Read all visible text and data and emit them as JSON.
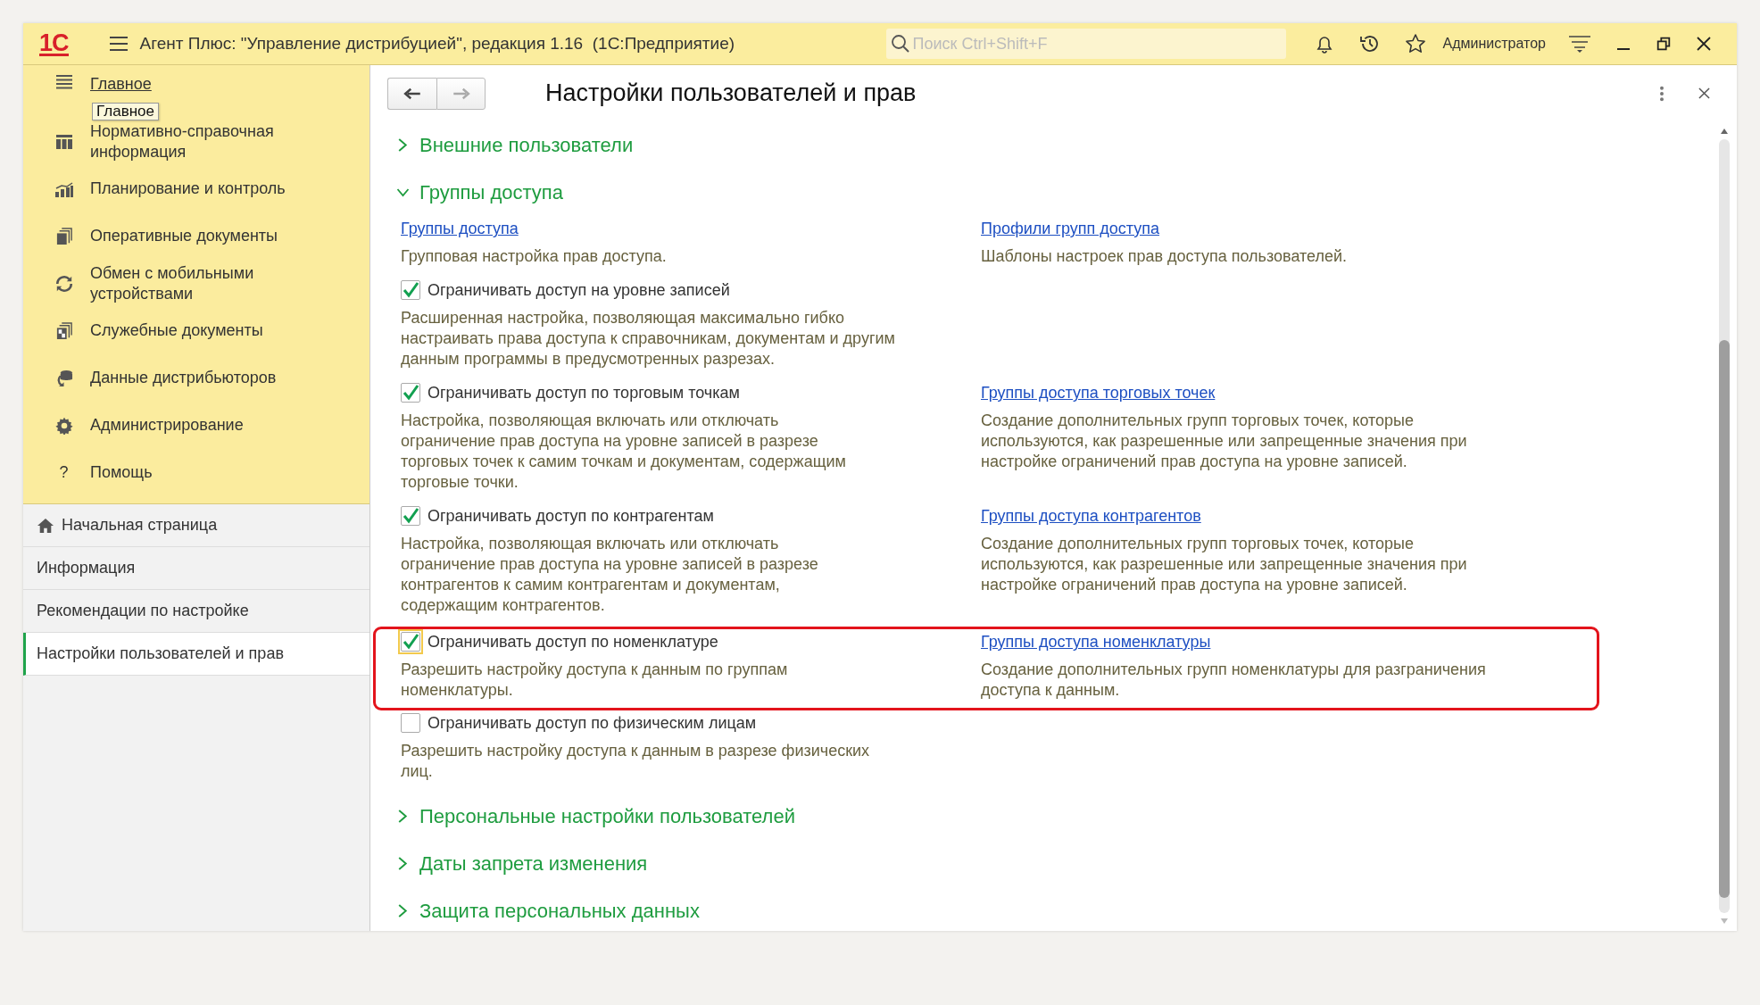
{
  "title_bar": {
    "logo": "1С",
    "title": "Агент Плюс: \"Управление дистрибуцией\", редакция 1.16  (1С:Предприятие)",
    "search": {
      "placeholder": "Поиск Ctrl+Shift+F"
    },
    "user": "Администратор"
  },
  "sidebar": {
    "sections": [
      {
        "label": "Главное",
        "selected": true
      },
      {
        "label": "Нормативно-справочная\nинформация",
        "selected": false
      },
      {
        "label": "Планирование и контроль",
        "selected": false
      },
      {
        "label": "Оперативные документы",
        "selected": false
      },
      {
        "label": "Обмен с мобильными\nустройствами",
        "selected": false
      },
      {
        "label": "Служебные документы",
        "selected": false
      },
      {
        "label": "Данные дистрибьюторов",
        "selected": false
      },
      {
        "label": "Администрирование",
        "selected": false
      },
      {
        "label": "Помощь",
        "selected": false,
        "icon_text": "?"
      }
    ],
    "tooltip": "Главное",
    "open_pages": [
      {
        "label": "Начальная страница",
        "selected": false
      },
      {
        "label": "Информация",
        "selected": false
      },
      {
        "label": "Рекомендации по настройке",
        "selected": false
      },
      {
        "label": "Настройки пользователей и прав",
        "selected": true
      }
    ]
  },
  "form": {
    "title": "Настройки пользователей и прав",
    "navigation": {
      "back": {
        "disabled": false
      },
      "forward": {
        "disabled": true
      }
    },
    "groups": [
      {
        "title": "Внешние пользователи",
        "expanded": false
      },
      {
        "title": "Группы доступа",
        "expanded": true,
        "rows": [
          {
            "highlighted": false,
            "left": {
              "kind": "link",
              "text": "Группы доступа",
              "description": "Групповая настройка прав доступа."
            },
            "right": {
              "kind": "link",
              "text": "Профили групп доступа",
              "description": "Шаблоны настроек прав доступа пользователей."
            }
          },
          {
            "highlighted": false,
            "left": {
              "kind": "checkbox",
              "text": "Ограничивать доступ на уровне записей",
              "checked": true,
              "focused": false,
              "description": "Расширенная настройка, позволяющая максимально гибко\nнастраивать права доступа к справочникам, документам и другим\nданным программы в предусмотренных разрезах."
            }
          },
          {
            "highlighted": false,
            "left": {
              "kind": "checkbox",
              "text": "Ограничивать доступ по торговым точкам",
              "checked": true,
              "focused": false,
              "description": "Настройка, позволяющая включать или отключать\nограничение прав доступа на уровне записей в разрезе\nторговых точек к самим точкам и документам, содержащим\nторговые точки."
            },
            "right": {
              "kind": "link",
              "text": "Группы доступа торговых точек",
              "description": "Создание дополнительных групп торговых точек, которые\nиспользуются, как разрешенные или запрещенные значения при\nнастройке ограничений прав доступа на уровне записей."
            }
          },
          {
            "highlighted": false,
            "left": {
              "kind": "checkbox",
              "text": "Ограничивать доступ по контрагентам",
              "checked": true,
              "focused": false,
              "description": "Настройка, позволяющая включать или отключать\nограничение прав доступа на уровне записей в разрезе\nконтрагентов к самим контрагентам и документам,\nсодержащим контрагентов."
            },
            "right": {
              "kind": "link",
              "text": "Группы доступа контрагентов",
              "description": "Создание дополнительных групп торговых точек, которые\nиспользуются, как разрешенные или запрещенные значения при\nнастройке ограничений прав доступа на уровне записей."
            }
          },
          {
            "highlighted": true,
            "left": {
              "kind": "checkbox",
              "text": "Ограничивать доступ по номенклатуре",
              "checked": true,
              "focused": true,
              "description": "Разрешить настройку доступа к данным по группам\nноменклатуры."
            },
            "right": {
              "kind": "link",
              "text": "Группы доступа номенклатуры",
              "description": "Создание дополнительных групп номенклатуры для разграничения\nдоступа к данным."
            }
          },
          {
            "highlighted": false,
            "left": {
              "kind": "checkbox",
              "text": "Ограничивать доступ по физическим лицам",
              "checked": false,
              "focused": false,
              "description": "Разрешить настройку доступа к данным в разрезе физических\nлиц."
            }
          }
        ]
      },
      {
        "title": "Персональные настройки пользователей",
        "expanded": false
      },
      {
        "title": "Даты запрета изменения",
        "expanded": false
      },
      {
        "title": "Защита персональных данных",
        "expanded": false
      }
    ]
  }
}
